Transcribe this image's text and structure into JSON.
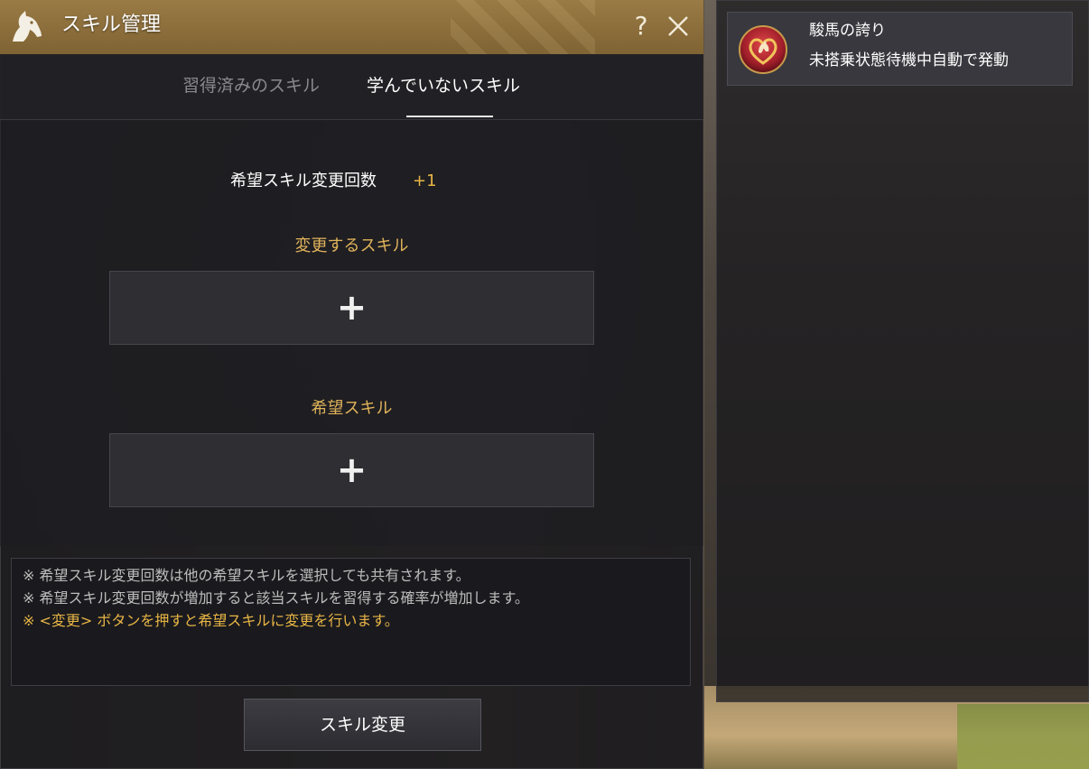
{
  "window": {
    "title": "スキル管理",
    "help_label": "?",
    "tabs": [
      {
        "label": "習得済みのスキル",
        "active": false
      },
      {
        "label": "学んでいないスキル",
        "active": true
      }
    ]
  },
  "content": {
    "change_count_label": "希望スキル変更回数",
    "change_count_value": "+1",
    "skill_to_change_label": "変更するスキル",
    "desired_skill_label": "希望スキル",
    "slot_plus": "+"
  },
  "notes": [
    {
      "text": "※ 希望スキル変更回数は他の希望スキルを選択しても共有されます。",
      "highlight": false
    },
    {
      "text": "※ 希望スキル変更回数が増加すると該当スキルを習得する確率が増加します。",
      "highlight": false
    },
    {
      "text": "※ <変更> ボタンを押すと希望スキルに変更を行います。",
      "highlight": true
    }
  ],
  "change_button_label": "スキル変更",
  "side_panel": {
    "skill": {
      "name": "駿馬の誇り",
      "description": "未搭乗状態待機中自動で発動",
      "icon": "horse-heart-icon"
    }
  },
  "colors": {
    "title_bar": "#8a6c3a",
    "accent_gold": "#e8b545",
    "section_label": "#e0b35a",
    "panel_bg": "#1e1e22"
  }
}
